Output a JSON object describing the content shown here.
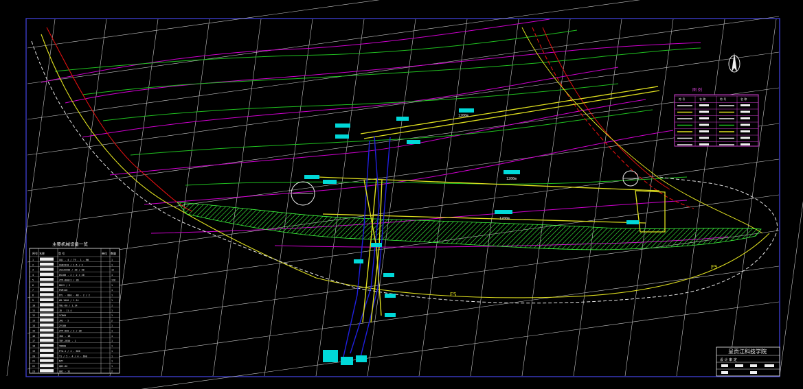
{
  "colors": {
    "background": "#000000",
    "border": "#3c3cc8",
    "grid": "#c8c8c8",
    "contour_magenta": "#d000d0",
    "contour_green": "#20c020",
    "fault_red": "#e01010",
    "boundary_yellow": "#e0e020",
    "boundary_white": "#e8e8e8",
    "roadway_blue": "#2020e0",
    "hatch_green": "#40ff40",
    "label_cyan": "#00d8d8",
    "text_white": "#f0f0f0",
    "legend_magenta": "#d040d0"
  },
  "title_block": {
    "company": "呈贡江科技学院",
    "row2": "设 计 审 定"
  },
  "equipment_table": {
    "title": "主要机械设备一览",
    "headers": [
      "序号",
      "名称",
      "型 号",
      "单位",
      "数量"
    ],
    "rows": [
      [
        "1",
        "XQ1 - 4 / 79 - 1 - KW",
        "1"
      ],
      [
        "2",
        "GSB2320 / 1.5 / 3",
        "1"
      ],
      [
        "3",
        "ZGSZ2000 / 2B / 80",
        "12"
      ],
      [
        "4",
        "DSJ80 - 2 / 2 × 40",
        "1"
      ],
      [
        "5",
        "ZTP-800/2 / 2B",
        "126"
      ],
      [
        "6",
        "DDJ2 / 2",
        "1"
      ],
      [
        "7",
        "PGM110",
        "1"
      ],
      [
        "8",
        "DTL - 800 - 4B - 2 / 2",
        "1"
      ],
      [
        "9",
        "KB-1000 / 1.14",
        "1"
      ],
      [
        "10",
        "YBL-60 / 1.14",
        "1"
      ],
      [
        "11",
        "JD - 11.4",
        "1"
      ],
      [
        "12",
        "YCB60",
        "1"
      ],
      [
        "13",
        "JH2 - 5",
        "2"
      ],
      [
        "14",
        "ZYJ80",
        "1"
      ],
      [
        "15",
        "ZTP-800 / 2 / 2B",
        "1"
      ],
      [
        "16",
        "1KG - 1B",
        "1"
      ],
      [
        "17",
        "TBF-2B50 - 1",
        "1"
      ],
      [
        "18",
        "YBD80",
        "1"
      ],
      [
        "19",
        "FYA-1 / 4 - 660",
        "1"
      ],
      [
        "20",
        "T1 / 5 - 4 / 4 - 660",
        "1"
      ],
      [
        "21",
        "MZY",
        "1"
      ],
      [
        "22",
        "QBZ-80",
        "1"
      ],
      [
        "23",
        "QBZ - 31",
        "2"
      ]
    ]
  },
  "legend": {
    "title": "图 例",
    "headers": [
      "符 号",
      "名 称",
      "符 号",
      "名 称"
    ]
  },
  "labels": {
    "f5_a": "F5",
    "f5_b": "F5",
    "length_1": "1200m",
    "length_2": "1200m",
    "length_3": "1200m"
  }
}
